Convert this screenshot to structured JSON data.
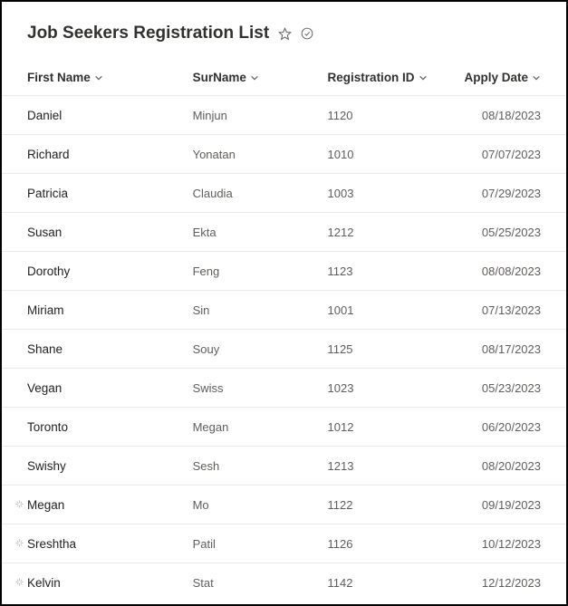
{
  "header": {
    "title": "Job Seekers Registration List"
  },
  "columns": {
    "firstName": "First Name",
    "surName": "SurName",
    "registrationId": "Registration ID",
    "applyDate": "Apply Date"
  },
  "rows": [
    {
      "firstName": "Daniel",
      "surName": "Minjun",
      "registrationId": "1120",
      "applyDate": "08/18/2023",
      "isNew": false
    },
    {
      "firstName": "Richard",
      "surName": "Yonatan",
      "registrationId": "1010",
      "applyDate": "07/07/2023",
      "isNew": false
    },
    {
      "firstName": "Patricia",
      "surName": "Claudia",
      "registrationId": "1003",
      "applyDate": "07/29/2023",
      "isNew": false
    },
    {
      "firstName": "Susan",
      "surName": "Ekta",
      "registrationId": "1212",
      "applyDate": "05/25/2023",
      "isNew": false
    },
    {
      "firstName": "Dorothy",
      "surName": "Feng",
      "registrationId": "1123",
      "applyDate": "08/08/2023",
      "isNew": false
    },
    {
      "firstName": "Miriam",
      "surName": "Sin",
      "registrationId": "1001",
      "applyDate": "07/13/2023",
      "isNew": false
    },
    {
      "firstName": "Shane",
      "surName": "Souy",
      "registrationId": "1125",
      "applyDate": "08/17/2023",
      "isNew": false
    },
    {
      "firstName": "Vegan",
      "surName": "Swiss",
      "registrationId": "1023",
      "applyDate": "05/23/2023",
      "isNew": false
    },
    {
      "firstName": "Toronto",
      "surName": "Megan",
      "registrationId": "1012",
      "applyDate": "06/20/2023",
      "isNew": false
    },
    {
      "firstName": "Swishy",
      "surName": "Sesh",
      "registrationId": "1213",
      "applyDate": "08/20/2023",
      "isNew": false
    },
    {
      "firstName": "Megan",
      "surName": "Mo",
      "registrationId": "1122",
      "applyDate": "09/19/2023",
      "isNew": true
    },
    {
      "firstName": "Sreshtha",
      "surName": "Patil",
      "registrationId": "1126",
      "applyDate": "10/12/2023",
      "isNew": true
    },
    {
      "firstName": "Kelvin",
      "surName": "Stat",
      "registrationId": "1142",
      "applyDate": "12/12/2023",
      "isNew": true
    }
  ]
}
